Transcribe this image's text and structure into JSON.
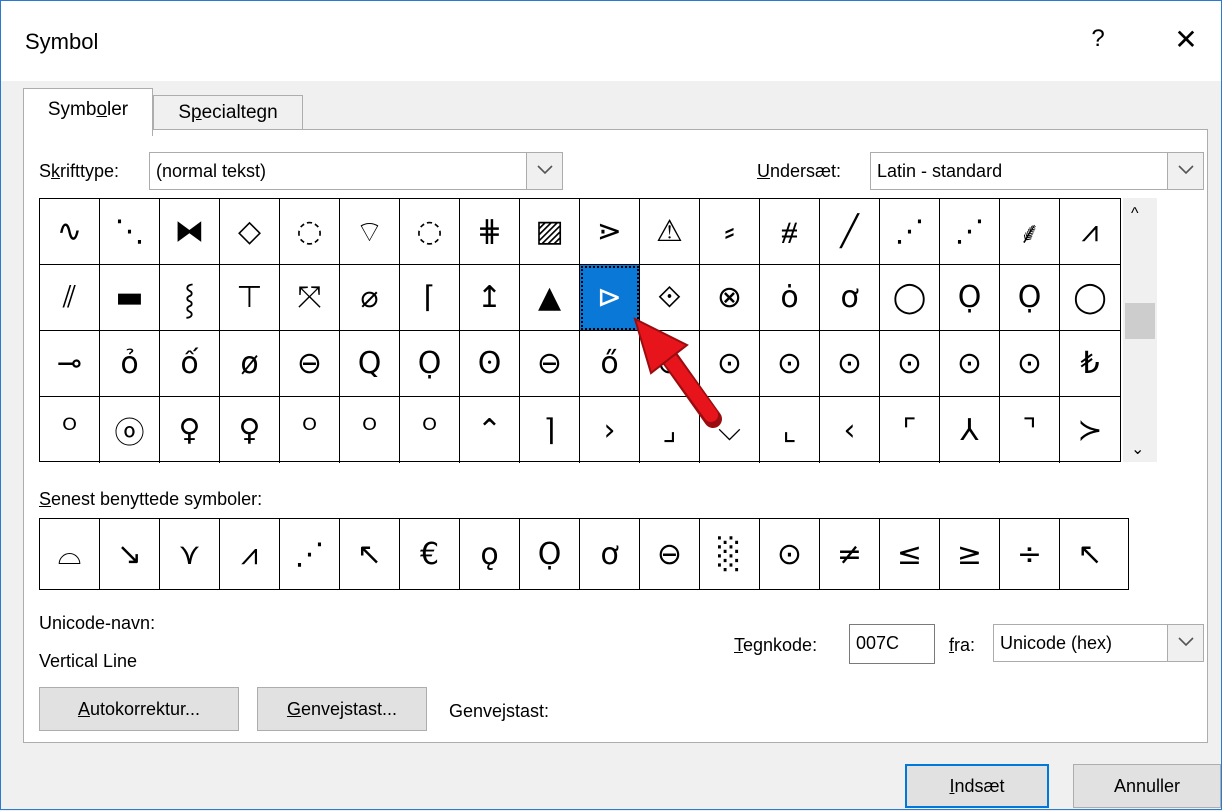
{
  "window": {
    "title": "Symbol",
    "help": "?",
    "close": "✕"
  },
  "tabs": [
    {
      "pre": "Symb",
      "acc": "o",
      "post": "ler"
    },
    {
      "pre": "S",
      "acc": "p",
      "post": "ecialtegn"
    }
  ],
  "font": {
    "pre": "S",
    "acc": "k",
    "post": "rifttype:",
    "value": "(normal tekst)"
  },
  "subset": {
    "pre": "",
    "acc": "U",
    "post": "ndersæt:",
    "value": "Latin - standard"
  },
  "symbol_grid": {
    "rows": [
      [
        "∿",
        "⋱",
        "⧓",
        "◇",
        "◌",
        "⌔",
        "◌",
        "⋕",
        "▨",
        "⋗",
        "⚠",
        "⸗",
        "⧣",
        "╱",
        "⋰",
        "⋰",
        "⸙",
        "⩘"
      ],
      [
        "⫽",
        "▬",
        "⸾",
        "⊤",
        "⤧",
        "⌀",
        "⌈",
        "↥",
        "▲",
        "⊳",
        "⟐",
        "⊗",
        "ȯ",
        "ơ",
        "◯",
        "Ọ",
        "Ọ",
        "◯"
      ],
      [
        "⊸",
        "ỏ",
        "ố",
        "ø",
        "⊖",
        "Q",
        "Ọ",
        "ʘ",
        "⊖",
        "ő",
        "⊙",
        "⊙",
        "⊙",
        "⊙",
        "⊙",
        "⊙",
        "⊙",
        "₺"
      ],
      [
        "ᴼ",
        "ⓞ",
        "♀",
        "♀",
        "ᴼ",
        "ᴼ",
        "ᴼ",
        "⌃",
        "⌉",
        "›",
        "⌟",
        "⌵",
        "⌞",
        "‹",
        "⌜",
        "⅄",
        "⌝",
        "≻"
      ]
    ],
    "selected": {
      "row": 1,
      "col": 9
    }
  },
  "recent": {
    "label_pre": "",
    "label_acc": "S",
    "label_post": "enest benyttede symboler:",
    "items": [
      "⌓",
      "↘",
      "⋎",
      "⩘",
      "⋰",
      "↖",
      "€",
      "ǫ",
      "Ọ",
      "ơ",
      "⊖",
      "░",
      "⊙",
      "≠",
      "≤",
      "≥",
      "÷",
      "↖"
    ]
  },
  "unicode_name": {
    "label": "Unicode-navn:",
    "value": "Vertical Line"
  },
  "char_code": {
    "pre": "",
    "acc": "T",
    "post": "egnkode:",
    "value": "007C"
  },
  "from": {
    "pre": "",
    "acc": "f",
    "post": "ra:",
    "value": "Unicode (hex)"
  },
  "buttons": {
    "autocorrect": {
      "pre": "",
      "acc": "A",
      "post": "utokorrektur..."
    },
    "shortcut_key": {
      "pre": "",
      "acc": "G",
      "post": "envejstast..."
    },
    "shortcut_label": "Genvejstast:",
    "insert": {
      "pre": "",
      "acc": "I",
      "post": "ndsæt"
    },
    "cancel": "Annuller"
  },
  "colors": {
    "selection": "#0a78d7",
    "arrow": "#e8141b",
    "default_border": "#0078d7"
  }
}
